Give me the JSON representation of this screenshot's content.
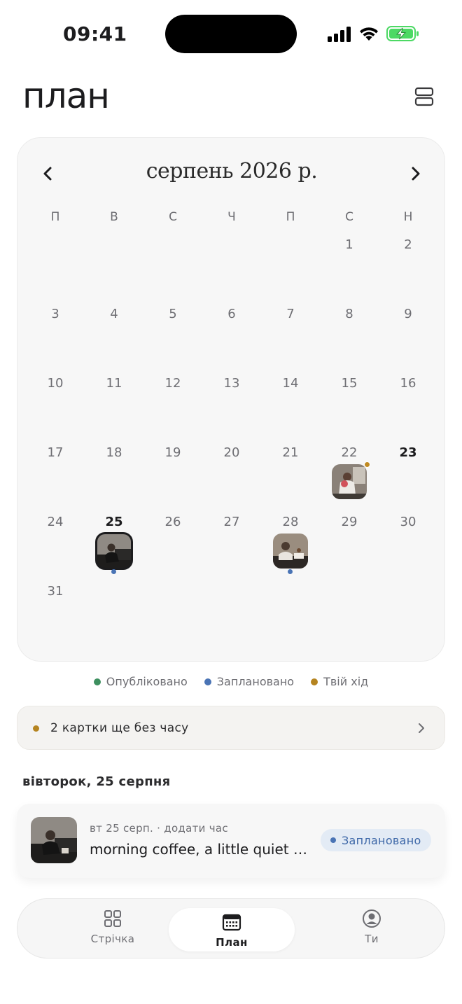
{
  "status_bar": {
    "time": "09:41"
  },
  "header": {
    "title": "план",
    "view_toggle_icon": "list-rows-icon"
  },
  "calendar": {
    "month_title": "серпень 2026 р.",
    "weekdays": [
      "П",
      "В",
      "С",
      "Ч",
      "П",
      "С",
      "Н"
    ],
    "leading_blanks": 5,
    "days": [
      {
        "n": "1"
      },
      {
        "n": "2"
      },
      {
        "n": "3"
      },
      {
        "n": "4"
      },
      {
        "n": "5"
      },
      {
        "n": "6"
      },
      {
        "n": "7"
      },
      {
        "n": "8"
      },
      {
        "n": "9"
      },
      {
        "n": "10"
      },
      {
        "n": "11"
      },
      {
        "n": "12"
      },
      {
        "n": "13"
      },
      {
        "n": "14"
      },
      {
        "n": "15"
      },
      {
        "n": "16"
      },
      {
        "n": "17"
      },
      {
        "n": "18"
      },
      {
        "n": "19"
      },
      {
        "n": "20"
      },
      {
        "n": "21"
      },
      {
        "n": "22",
        "post": "your-turn"
      },
      {
        "n": "23",
        "bold": true
      },
      {
        "n": "24"
      },
      {
        "n": "25",
        "bold": true,
        "post": "scheduled",
        "selected": true
      },
      {
        "n": "26"
      },
      {
        "n": "27"
      },
      {
        "n": "28",
        "post": "scheduled"
      },
      {
        "n": "29"
      },
      {
        "n": "30"
      },
      {
        "n": "31"
      }
    ]
  },
  "legend": [
    {
      "label": "Опубліковано",
      "color": "#3d8f5f"
    },
    {
      "label": "Заплановано",
      "color": "#4a74b5"
    },
    {
      "label": "Твій хід",
      "color": "#b58420"
    }
  ],
  "untimed_banner": {
    "label": "2 картки ще без часу"
  },
  "day_section": {
    "heading": "вівторок, 25 серпня",
    "post": {
      "meta": "вт 25 серп. · додати час",
      "caption": "morning coffee, a little quiet time before the day starts",
      "status": "Заплановано"
    }
  },
  "tab_bar": {
    "tabs": [
      {
        "label": "Стрічка",
        "icon": "grid-icon"
      },
      {
        "label": "План",
        "icon": "calendar-icon"
      },
      {
        "label": "Ти",
        "icon": "profile-icon"
      }
    ]
  }
}
